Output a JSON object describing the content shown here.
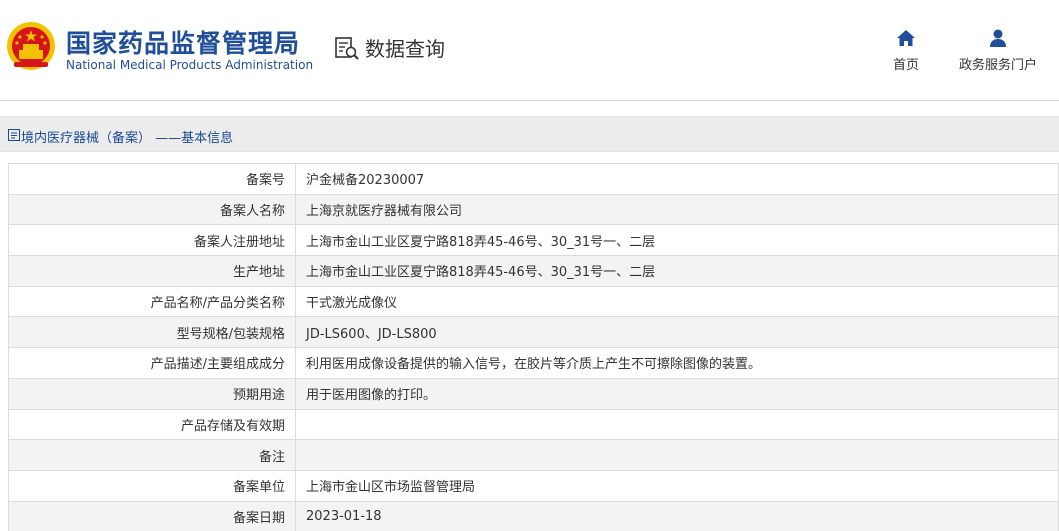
{
  "header": {
    "title_cn": "国家药品监督管理局",
    "title_en": "National Medical Products Administration",
    "query_label": "数据查询",
    "nav": [
      {
        "label": "首页",
        "icon": "home-icon"
      },
      {
        "label": "政务服务门户",
        "icon": "user-icon"
      }
    ]
  },
  "breadcrumb": {
    "text": "境内医疗器械（备案） ——基本信息"
  },
  "rows": [
    {
      "label": "备案号",
      "value": "沪金械备20230007"
    },
    {
      "label": "备案人名称",
      "value": "上海京就医疗器械有限公司"
    },
    {
      "label": "备案人注册地址",
      "value": "上海市金山工业区夏宁路818弄45-46号、30_31号一、二层"
    },
    {
      "label": "生产地址",
      "value": "上海市金山工业区夏宁路818弄45-46号、30_31号一、二层"
    },
    {
      "label": "产品名称/产品分类名称",
      "value": "干式激光成像仪"
    },
    {
      "label": "型号规格/包装规格",
      "value": "JD-LS600、JD-LS800"
    },
    {
      "label": "产品描述/主要组成成分",
      "value": "利用医用成像设备提供的输入信号，在胶片等介质上产生不可擦除图像的装置。"
    },
    {
      "label": "预期用途",
      "value": "用于医用图像的打印。"
    },
    {
      "label": "产品存储及有效期",
      "value": ""
    },
    {
      "label": "备注",
      "value": ""
    },
    {
      "label": "备案单位",
      "value": "上海市金山区市场监督管理局"
    },
    {
      "label": "备案日期",
      "value": "2023-01-18"
    }
  ],
  "colors": {
    "brand": "#1f4e9a",
    "emblem_red": "#d7141a",
    "emblem_gold": "#f2c200",
    "nav_icon": "#1f4e9a",
    "crumb_text": "#1a4a94"
  }
}
